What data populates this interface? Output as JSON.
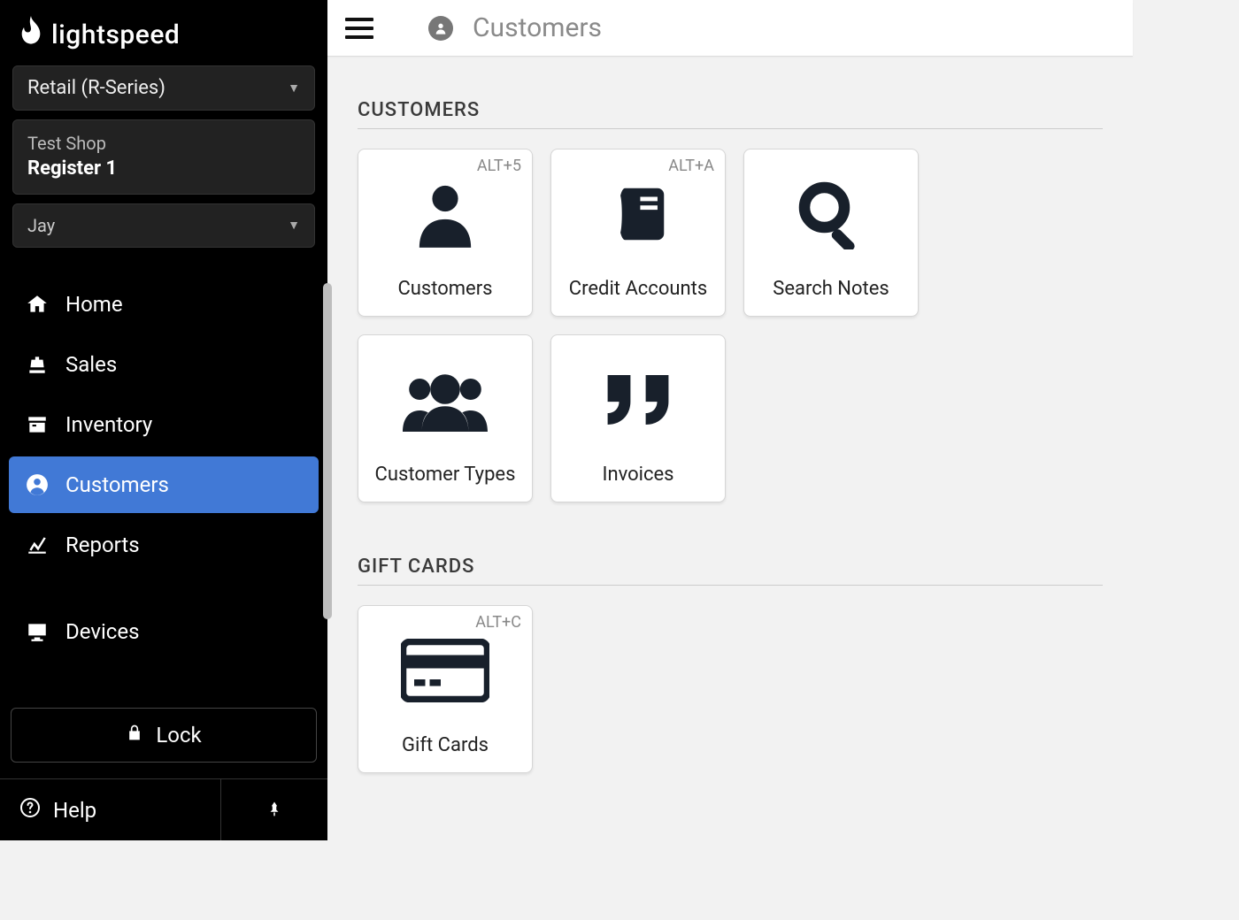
{
  "brand": "lightspeed",
  "sidebar": {
    "product_selector": "Retail (R-Series)",
    "shop_line1": "Test Shop",
    "shop_line2": "Register 1",
    "user": "Jay",
    "nav": {
      "home": "Home",
      "sales": "Sales",
      "inventory": "Inventory",
      "customers": "Customers",
      "reports": "Reports",
      "devices": "Devices"
    },
    "lock": "Lock",
    "help": "Help"
  },
  "topbar": {
    "title": "Customers"
  },
  "sections": {
    "customers": {
      "title": "CUSTOMERS",
      "tiles": {
        "customers": {
          "label": "Customers",
          "shortcut": "ALT+5"
        },
        "credit_accounts": {
          "label": "Credit Accounts",
          "shortcut": "ALT+A"
        },
        "search_notes": {
          "label": "Search Notes",
          "shortcut": ""
        },
        "customer_types": {
          "label": "Customer Types",
          "shortcut": ""
        },
        "invoices": {
          "label": "Invoices",
          "shortcut": ""
        }
      }
    },
    "gift_cards": {
      "title": "GIFT CARDS",
      "tiles": {
        "gift_cards": {
          "label": "Gift Cards",
          "shortcut": "ALT+C"
        }
      }
    }
  }
}
